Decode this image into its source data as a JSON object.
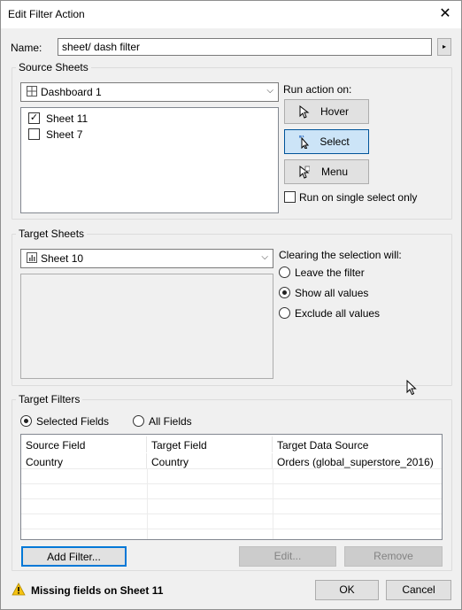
{
  "window": {
    "title": "Edit Filter Action",
    "close_glyph": "✕"
  },
  "name": {
    "label": "Name:",
    "value": "sheet/ dash filter",
    "arrow_glyph": "▸"
  },
  "source_sheets": {
    "group_label": "Source Sheets",
    "dashboard": "Dashboard 1",
    "sheets": [
      {
        "label": "Sheet 11",
        "checked": true
      },
      {
        "label": "Sheet 7",
        "checked": false
      }
    ]
  },
  "run_action": {
    "label": "Run action on:",
    "hover": "Hover",
    "select": "Select",
    "menu": "Menu",
    "single_select": "Run on single select only"
  },
  "target_sheets": {
    "group_label": "Target Sheets",
    "sheet": "Sheet 10",
    "clearing_label": "Clearing the selection will:",
    "options": [
      "Leave the filter",
      "Show all values",
      "Exclude all values"
    ],
    "selected_option": "Show all values"
  },
  "target_filters": {
    "group_label": "Target Filters",
    "mode_selected_fields": "Selected Fields",
    "mode_all_fields": "All Fields",
    "columns": [
      "Source Field",
      "Target Field",
      "Target Data Source"
    ],
    "rows": [
      [
        "Country",
        "Country",
        "Orders (global_superstore_2016)"
      ]
    ],
    "add_filter": "Add Filter...",
    "edit": "Edit...",
    "remove": "Remove"
  },
  "status": {
    "message": "Missing fields on Sheet 11"
  },
  "footer": {
    "ok": "OK",
    "cancel": "Cancel"
  },
  "colors": {
    "accent": "#0078d7",
    "selected_bg": "#cce4f7",
    "warning": "#f5c211"
  },
  "icons": [
    "close-icon",
    "dashboard-icon",
    "sheet-icon",
    "chevron-down-icon",
    "cursor-icon",
    "select-cursor-icon",
    "menu-cursor-icon",
    "warning-icon",
    "mouse-pointer-icon"
  ]
}
